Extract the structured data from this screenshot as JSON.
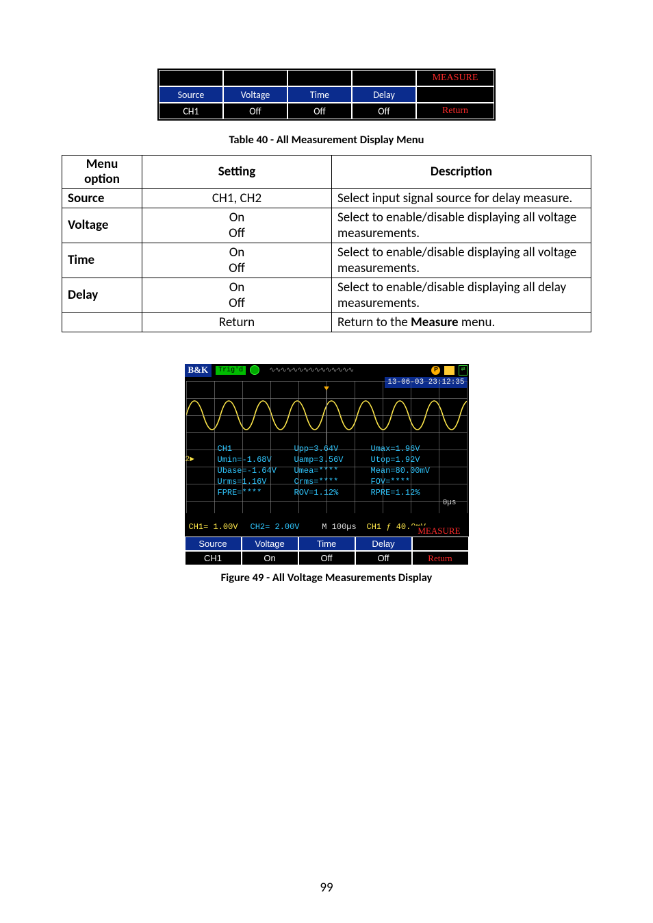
{
  "topmenu": {
    "measure_label": "MEASURE",
    "headers": [
      "Source",
      "Voltage",
      "Time",
      "Delay"
    ],
    "values": [
      "CH1",
      "Off",
      "Off",
      "Off"
    ],
    "return_label": "Return"
  },
  "table_caption": "Table 40 - All Measurement Display Menu",
  "table": {
    "head": [
      "Menu option",
      "Setting",
      "Description"
    ],
    "rows": [
      {
        "option": "Source",
        "setting": "CH1, CH2",
        "desc": "Select input signal source for delay measure."
      },
      {
        "option": "Voltage",
        "setting": "On\nOff",
        "desc": "Select to enable/disable displaying all voltage measurements."
      },
      {
        "option": "Time",
        "setting": "On\nOff",
        "desc": "Select to enable/disable displaying all voltage measurements."
      },
      {
        "option": "Delay",
        "setting": "On\nOff",
        "desc": "Select to enable/disable displaying all delay measurements."
      },
      {
        "option": "",
        "setting": "Return",
        "desc": "Return to the Measure menu.",
        "desc_bold": "Measure"
      }
    ]
  },
  "scope": {
    "logo": "B&K",
    "trigd": "Trig'd",
    "datetime": "13-06-03 23:12:35",
    "p_label": "P",
    "conn": "⇄",
    "ch_label": "CH1",
    "ymarker": "2►",
    "meas_rows": [
      [
        "Upp=3.64V",
        "Umax=1.96V"
      ],
      [
        "Umin=-1.68V",
        "Uamp=3.56V",
        "Utop=1.92V"
      ],
      [
        "Ubase=-1.64V",
        "Umea=****",
        "Mean=80.00mV"
      ],
      [
        "Urms=1.16V",
        "Crms=****",
        "FOV=****"
      ],
      [
        "FPRE=****",
        "ROV=1.12%",
        "RPRE=1.12%"
      ]
    ],
    "cursor_us": "0µs",
    "status": {
      "ch1": "CH1= 1.00V",
      "ch2": "CH2= 2.00V",
      "m": "M 100µs",
      "trig": "CH1 ƒ 40.0mV",
      "measure": "MEASURE"
    },
    "menu": {
      "headers": [
        "Source",
        "Voltage",
        "Time",
        "Delay"
      ],
      "values": [
        "CH1",
        "On",
        "Off",
        "Off"
      ],
      "return_label": "Return"
    }
  },
  "figure_caption": "Figure 49 - All Voltage Measurements Display",
  "page_number": "99"
}
